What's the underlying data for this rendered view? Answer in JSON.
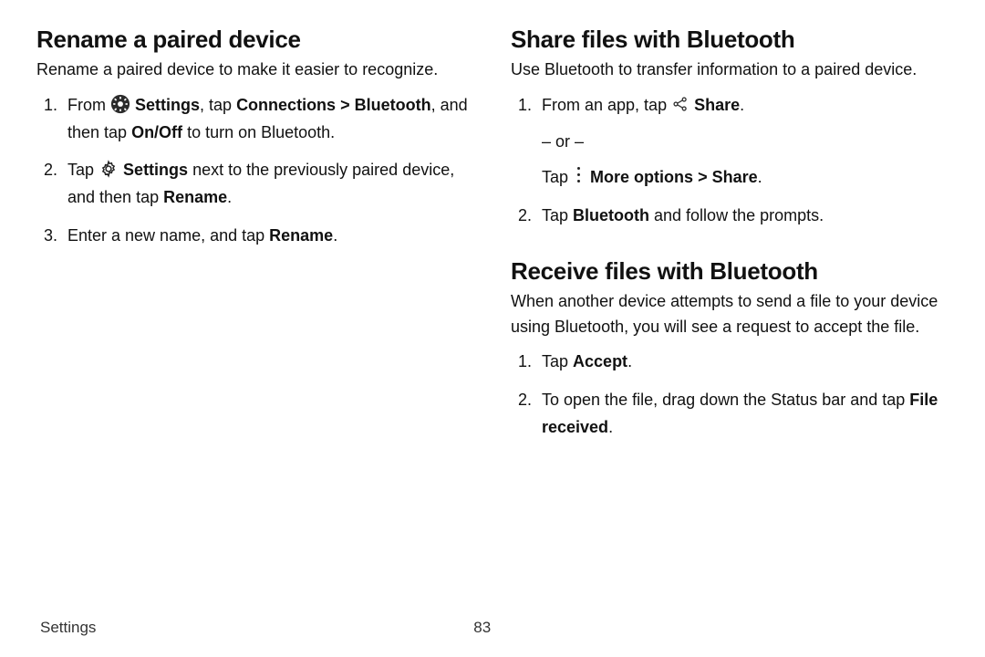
{
  "left": {
    "h1": "Rename a paired device",
    "lead": "Rename a paired device to make it easier to recognize.",
    "s1_a": "From ",
    "s1_settings": "Settings",
    "s1_b": ", tap ",
    "s1_connections": "Connections",
    "s1_c": "Bluetooth",
    "s1_d": ", and then tap ",
    "s1_onoff": "On/Off",
    "s1_e": " to turn on Bluetooth.",
    "s2_a": "Tap ",
    "s2_settings": "Settings",
    "s2_b": " next to the previously paired device, and then tap ",
    "s2_rename": "Rename",
    "s2_c": ".",
    "s3_a": "Enter a new name, and tap ",
    "s3_rename": "Rename",
    "s3_b": "."
  },
  "right1": {
    "h1": "Share files with Bluetooth",
    "lead": "Use Bluetooth to transfer information to a paired device.",
    "s1_a": "From an app, tap ",
    "s1_share": "Share",
    "s1_b": ".",
    "or": "– or –",
    "s1_c": "Tap ",
    "s1_more": "More options",
    "s1_d": "Share",
    "s1_e": ".",
    "s2_a": "Tap ",
    "s2_bt": "Bluetooth",
    "s2_b": " and follow the prompts."
  },
  "right2": {
    "h1": "Receive files with Bluetooth",
    "lead": "When another device attempts to send a file to your device using Bluetooth, you will see a request to accept the file.",
    "s1_a": "Tap ",
    "s1_accept": "Accept",
    "s1_b": ".",
    "s2_a": "To open the file, drag down the Status bar and tap ",
    "s2_file": "File received",
    "s2_b": "."
  },
  "footer": {
    "section": "Settings",
    "page": "83"
  },
  "glyph": {
    "chevron": ">"
  }
}
